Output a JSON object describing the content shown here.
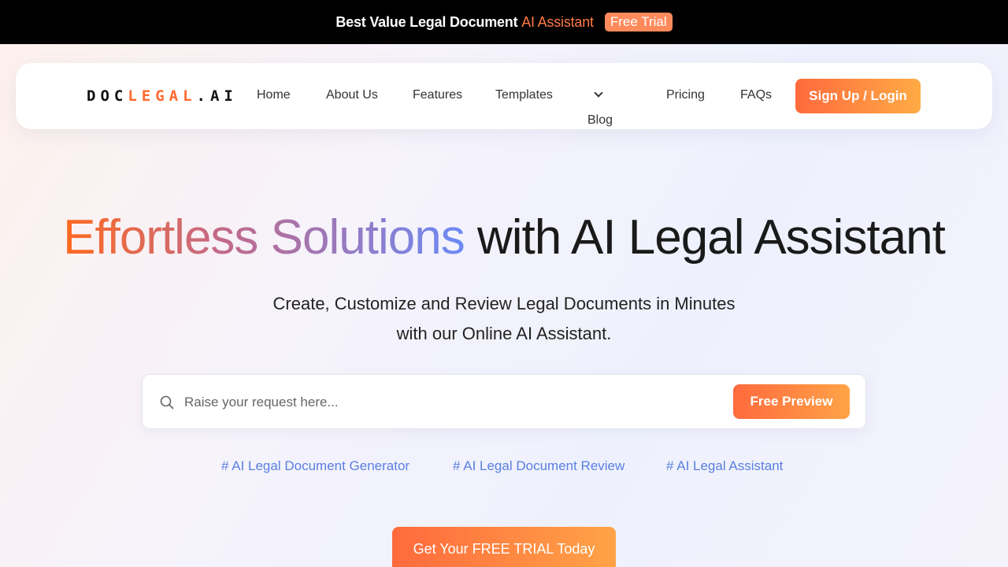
{
  "topbar": {
    "message": "Best Value Legal Document ",
    "highlight": "AI Assistant",
    "badge": "Free Trial"
  },
  "nav": {
    "logo_left": "DOC",
    "logo_mid": "LEGAL",
    "logo_right": ".AI",
    "items": [
      "Home",
      "About Us",
      "Features",
      "Templates",
      "Blog",
      "Pricing",
      "FAQs"
    ],
    "signup": "Sign Up / Login"
  },
  "hero": {
    "title_grad": "Effortless Solutions",
    "title_rest": " with AI Legal Assistant",
    "sub_line1": "Create, Customize and Review Legal Documents in Minutes",
    "sub_line2": "with our Online AI Assistant."
  },
  "search": {
    "placeholder": "Raise your request here...",
    "button": "Free Preview"
  },
  "tags": [
    "# AI Legal Document Generator",
    "# AI Legal Document Review",
    "# AI Legal Assistant"
  ],
  "cta": "Get Your FREE TRIAL Today",
  "colors": {
    "accent": "#ff6a3d",
    "accent_end": "#ffa347",
    "tag": "#5a7fe0"
  },
  "icons": {
    "search": "search-icon",
    "blog_dropdown": "chevron-down-icon"
  }
}
